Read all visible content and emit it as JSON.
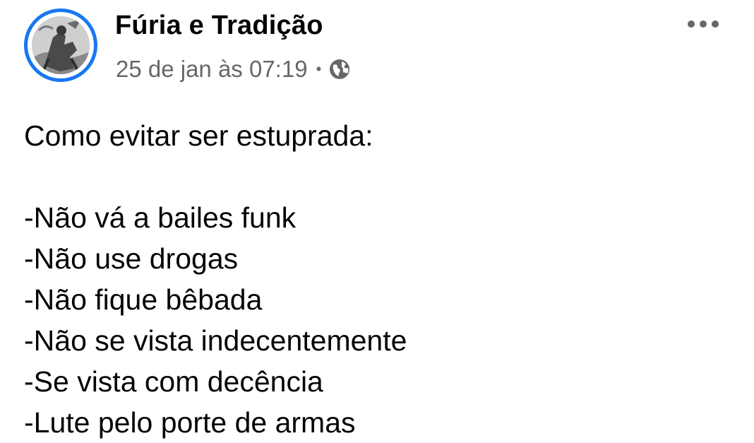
{
  "post": {
    "author_name": "Fúria e Tradição",
    "timestamp": "25 de jan às 07:19",
    "separator": "•",
    "audience_icon": "globe-icon",
    "more_icon": "more-options-icon",
    "avatar_icon": "page-avatar",
    "body": {
      "title_line": "Como evitar ser estuprada:",
      "lines": [
        "-Não vá a bailes funk",
        "-Não use drogas",
        "-Não fique bêbada",
        "-Não se vista indecentemente",
        "-Se vista com decência",
        "-Lute pelo porte de armas"
      ]
    }
  },
  "colors": {
    "accent": "#1877f2",
    "primary_text": "#050505",
    "secondary_text": "#65676b",
    "background": "#ffffff"
  }
}
